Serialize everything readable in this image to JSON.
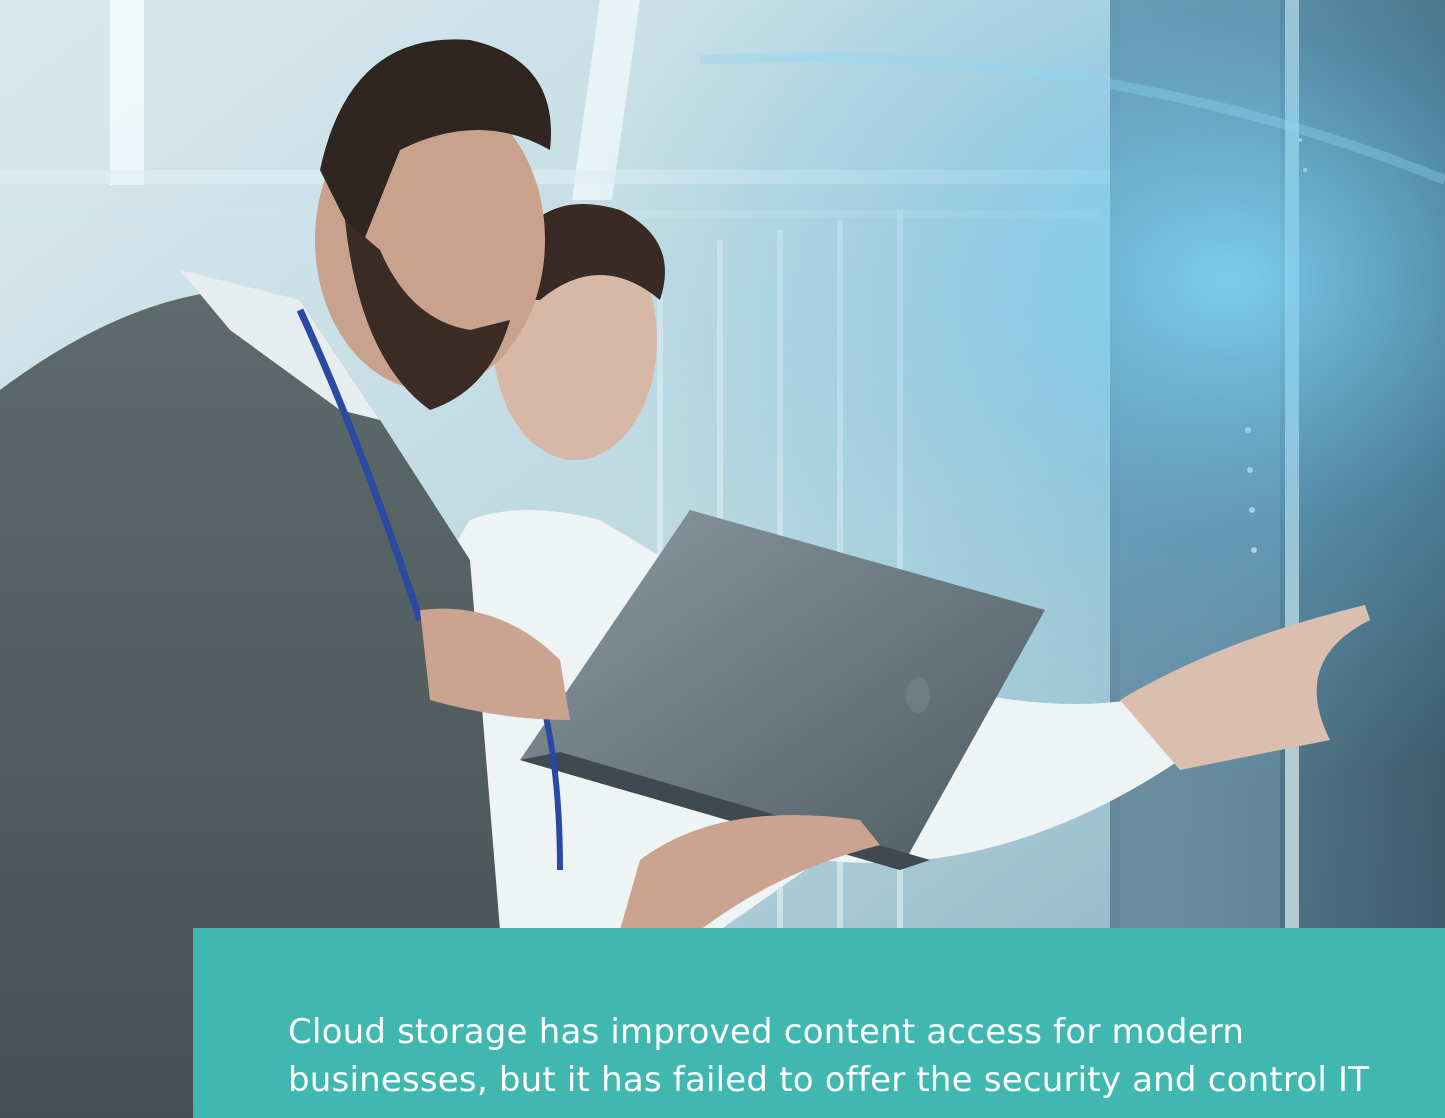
{
  "hero": {
    "image_description_icon": "photo-icon"
  },
  "caption": {
    "line1": "Cloud storage has improved content access for modern",
    "line2": "businesses, but it has failed to offer the security and control IT"
  },
  "colors": {
    "panel": "#40b8b0",
    "text": "#ffffff"
  }
}
